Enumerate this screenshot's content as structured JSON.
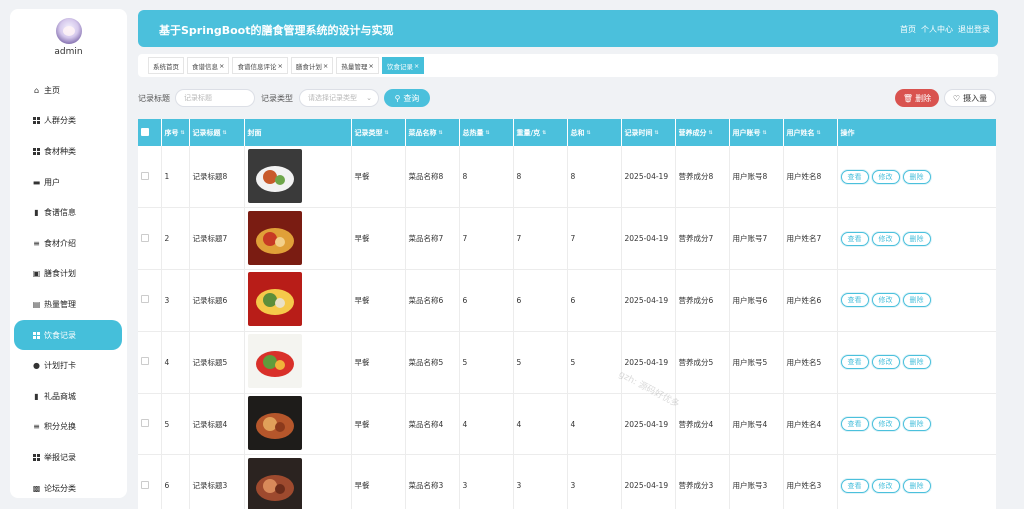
{
  "user": {
    "name": "admin"
  },
  "sidebar": {
    "items": [
      {
        "label": "主页",
        "icon": "home-icon"
      },
      {
        "label": "人群分类",
        "icon": "grid-icon"
      },
      {
        "label": "食材种类",
        "icon": "grid-icon"
      },
      {
        "label": "用户",
        "icon": "monitor-icon"
      },
      {
        "label": "食谱信息",
        "icon": "bar-chart-icon"
      },
      {
        "label": "食材介绍",
        "icon": "list-icon"
      },
      {
        "label": "膳食计划",
        "icon": "chart-icon"
      },
      {
        "label": "热量管理",
        "icon": "document-icon"
      },
      {
        "label": "饮食记录",
        "icon": "grid-icon",
        "active": true
      },
      {
        "label": "计划打卡",
        "icon": "user-icon"
      },
      {
        "label": "礼品商城",
        "icon": "bar-chart-icon"
      },
      {
        "label": "积分兑换",
        "icon": "list-icon"
      },
      {
        "label": "举报记录",
        "icon": "grid-icon"
      },
      {
        "label": "论坛分类",
        "icon": "clipboard-icon"
      }
    ]
  },
  "header": {
    "title": "基于SpringBoot的膳食管理系统的设计与实现",
    "links": [
      "首页",
      "个人中心",
      "退出登录"
    ]
  },
  "tabs": [
    {
      "label": "系统首页",
      "closable": false
    },
    {
      "label": "食谱信息",
      "closable": true
    },
    {
      "label": "食谱信息评论",
      "closable": true
    },
    {
      "label": "膳食计划",
      "closable": true
    },
    {
      "label": "热量管理",
      "closable": true
    },
    {
      "label": "饮食记录",
      "closable": true,
      "active": true
    }
  ],
  "search": {
    "title_label": "记录标题",
    "title_placeholder": "记录标题",
    "type_label": "记录类型",
    "type_placeholder": "请选择记录类型",
    "query_button": "查询",
    "delete_button": "删除",
    "intake_button": "摄入量"
  },
  "table": {
    "headers": [
      "序号",
      "记录标题",
      "封面",
      "记录类型",
      "菜品名称",
      "总热量",
      "重量/克",
      "总和",
      "记录时间",
      "营养成分",
      "用户账号",
      "用户姓名",
      "操作"
    ],
    "actions": [
      "查看",
      "修改",
      "删除"
    ],
    "rows": [
      {
        "no": "1",
        "title": "记录标题8",
        "type": "早餐",
        "dish": "菜品名称8",
        "calories": "8",
        "weight": "8",
        "total": "8",
        "time": "2025-04-19",
        "nutrition": "营养成分8",
        "account": "用户账号8",
        "name": "用户姓名8"
      },
      {
        "no": "2",
        "title": "记录标题7",
        "type": "早餐",
        "dish": "菜品名称7",
        "calories": "7",
        "weight": "7",
        "total": "7",
        "time": "2025-04-19",
        "nutrition": "营养成分7",
        "account": "用户账号7",
        "name": "用户姓名7"
      },
      {
        "no": "3",
        "title": "记录标题6",
        "type": "早餐",
        "dish": "菜品名称6",
        "calories": "6",
        "weight": "6",
        "total": "6",
        "time": "2025-04-19",
        "nutrition": "营养成分6",
        "account": "用户账号6",
        "name": "用户姓名6"
      },
      {
        "no": "4",
        "title": "记录标题5",
        "type": "早餐",
        "dish": "菜品名称5",
        "calories": "5",
        "weight": "5",
        "total": "5",
        "time": "2025-04-19",
        "nutrition": "营养成分5",
        "account": "用户账号5",
        "name": "用户姓名5"
      },
      {
        "no": "5",
        "title": "记录标题4",
        "type": "早餐",
        "dish": "菜品名称4",
        "calories": "4",
        "weight": "4",
        "total": "4",
        "time": "2025-04-19",
        "nutrition": "营养成分4",
        "account": "用户账号4",
        "name": "用户姓名4"
      },
      {
        "no": "6",
        "title": "记录标题3",
        "type": "早餐",
        "dish": "菜品名称3",
        "calories": "3",
        "weight": "3",
        "total": "3",
        "time": "2025-04-19",
        "nutrition": "营养成分3",
        "account": "用户账号3",
        "name": "用户姓名3"
      }
    ]
  },
  "watermark": "gzh: 源码好优多",
  "colors": {
    "accent": "#4bc0dc",
    "danger": "#d9534f",
    "background": "#f0f2f5"
  }
}
